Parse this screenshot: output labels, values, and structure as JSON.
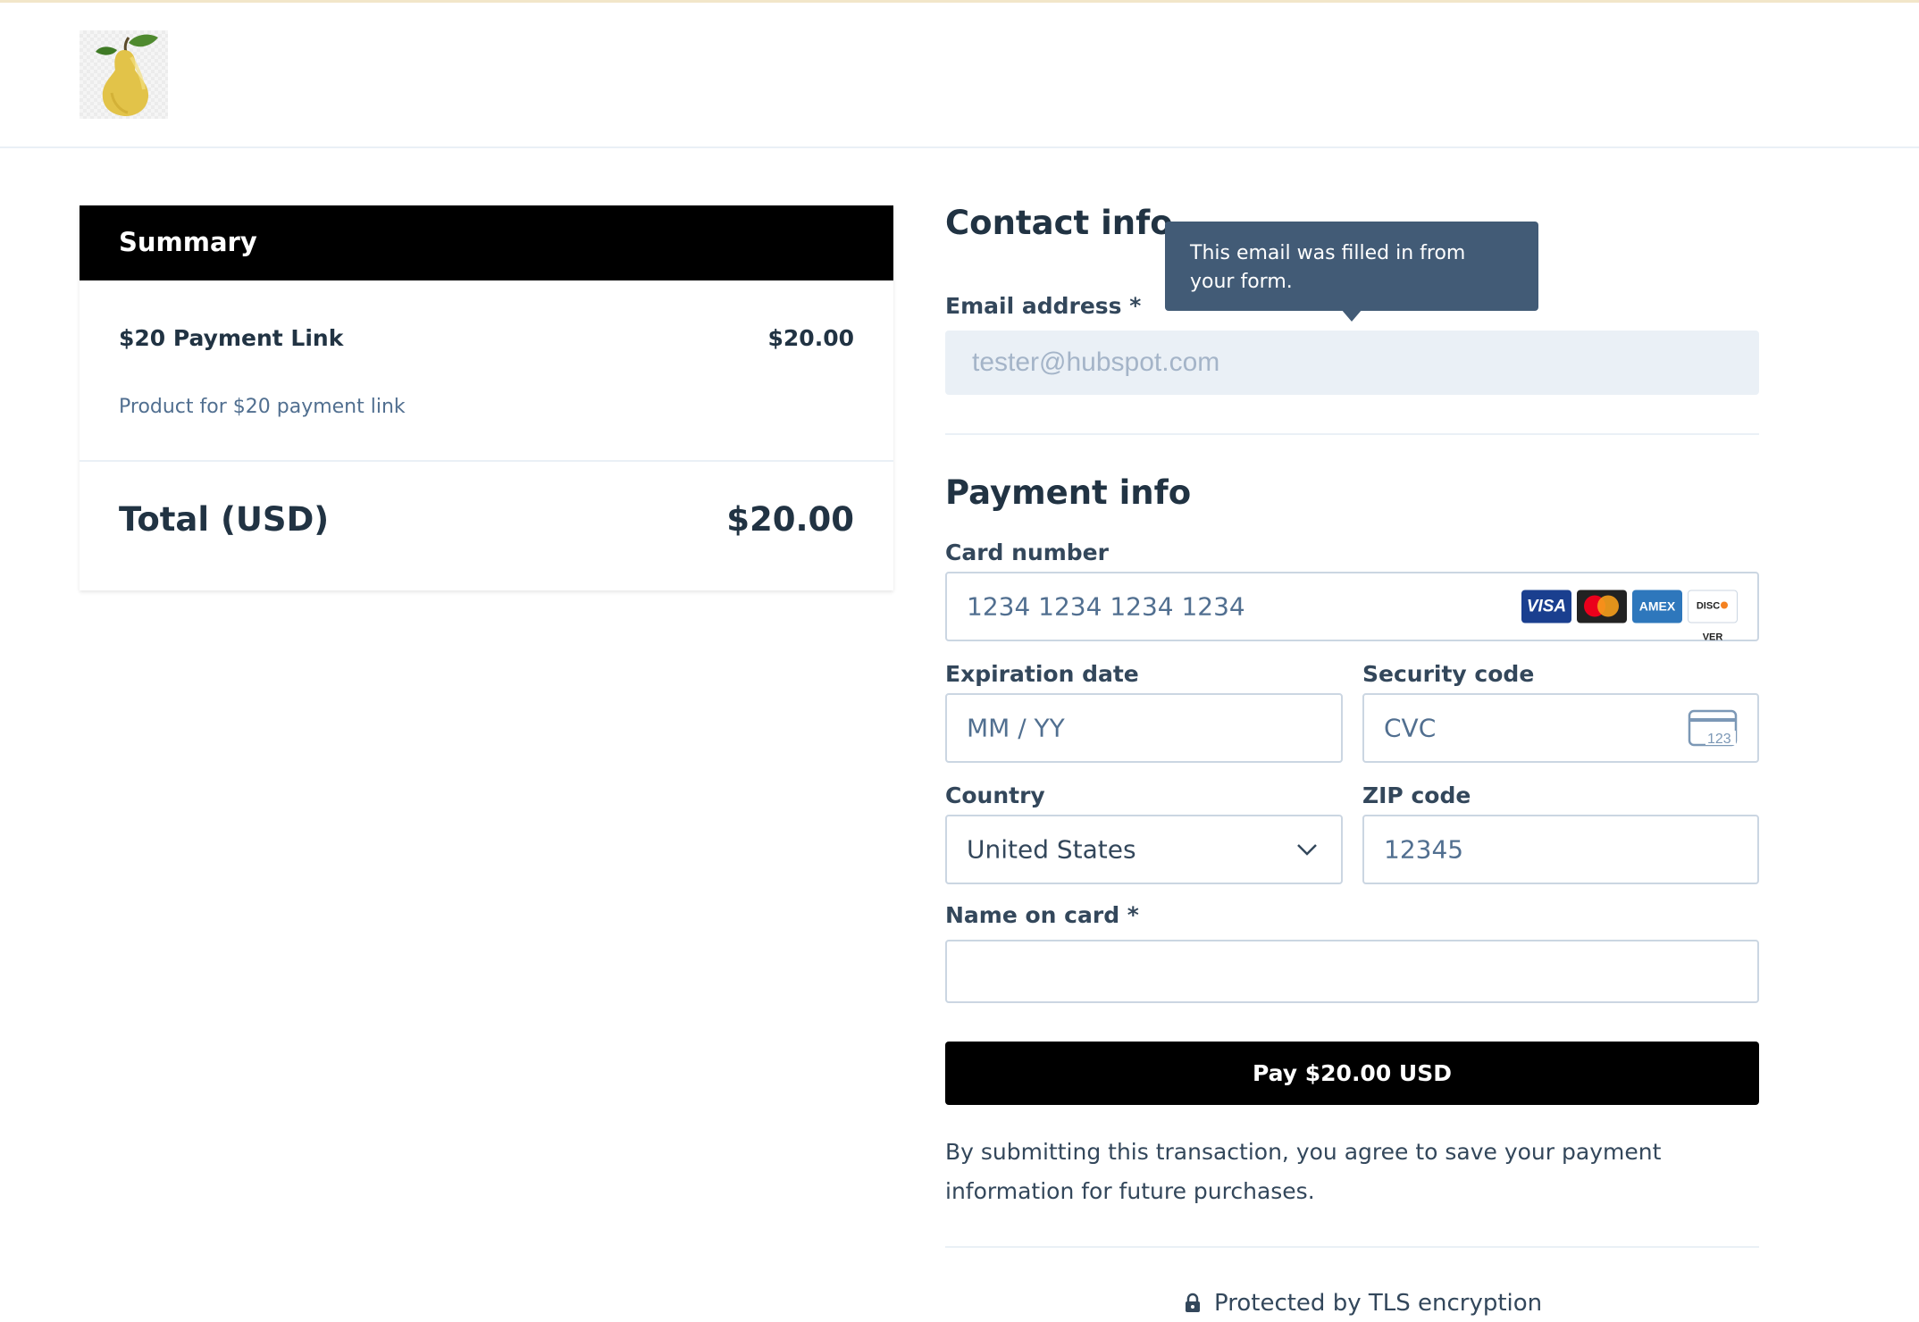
{
  "summary": {
    "title": "Summary",
    "item_name": "$20 Payment Link",
    "item_price": "$20.00",
    "item_description": "Product for $20 payment link",
    "total_label": "Total (USD)",
    "total_value": "$20.00"
  },
  "contact": {
    "title": "Contact info",
    "email_label": "Email address *",
    "email_value": "tester@hubspot.com",
    "tooltip": "This email was filled in from your form."
  },
  "payment": {
    "title": "Payment info",
    "card_number_label": "Card number",
    "card_number_placeholder": "1234 1234 1234 1234",
    "card_brands": [
      "VISA",
      "Mastercard",
      "AMEX",
      "DISCOVER"
    ],
    "expiration_label": "Expiration date",
    "expiration_placeholder": "MM / YY",
    "security_label": "Security code",
    "security_placeholder": "CVC",
    "cvc_icon_text": "123",
    "country_label": "Country",
    "country_value": "United States",
    "zip_label": "ZIP code",
    "zip_placeholder": "12345",
    "name_label": "Name on card *",
    "name_value": ""
  },
  "pay_button": "Pay $20.00 USD",
  "terms": "By submitting this transaction, you agree to save your payment information for future purchases.",
  "security_note": "Protected by TLS encryption",
  "colors": {
    "primary": "#000000",
    "text": "#33475b",
    "tooltip": "#425b76",
    "input_border": "#cbd6e2"
  }
}
